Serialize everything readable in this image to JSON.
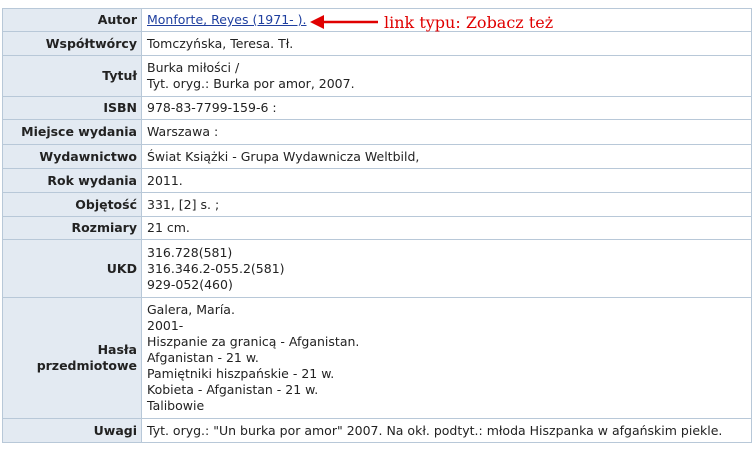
{
  "annotation": {
    "text": "link typu: Zobacz też",
    "color": "#e00000"
  },
  "record": {
    "author": {
      "label": "Autor",
      "value": "Monforte, Reyes (1971- )."
    },
    "contributors": {
      "label": "Współtwórcy",
      "value": "Tomczyńska, Teresa. Tł."
    },
    "title": {
      "label": "Tytuł",
      "lines": [
        "Burka miłości /",
        "Tyt. oryg.: Burka por amor, 2007."
      ]
    },
    "isbn": {
      "label": "ISBN",
      "value": "978-83-7799-159-6 :"
    },
    "place": {
      "label": "Miejsce wydania",
      "value": "Warszawa :"
    },
    "publisher": {
      "label": "Wydawnictwo",
      "value": "Świat Książki - Grupa Wydawnicza Weltbild,"
    },
    "year": {
      "label": "Rok wydania",
      "value": "2011."
    },
    "extent": {
      "label": "Objętość",
      "value": "331, [2] s. ;"
    },
    "dimensions": {
      "label": "Rozmiary",
      "value": "21 cm."
    },
    "udc": {
      "label": "UKD",
      "lines": [
        "316.728(581)",
        "316.346.2-055.2(581)",
        "929-052(460)"
      ]
    },
    "subjects": {
      "label_line1": "Hasła",
      "label_line2": "przedmiotowe",
      "lines": [
        "Galera, María.",
        "2001-",
        "Hiszpanie za granicą - Afganistan.",
        "Afganistan - 21 w.",
        "Pamiętniki hiszpańskie - 21 w.",
        "Kobieta - Afganistan - 21 w.",
        "Talibowie"
      ]
    },
    "notes": {
      "label": "Uwagi",
      "value": "Tyt. oryg.: \"Un burka por amor\" 2007. Na okł. podtyt.: młoda Hiszpanka w afgańskim piekle."
    }
  }
}
